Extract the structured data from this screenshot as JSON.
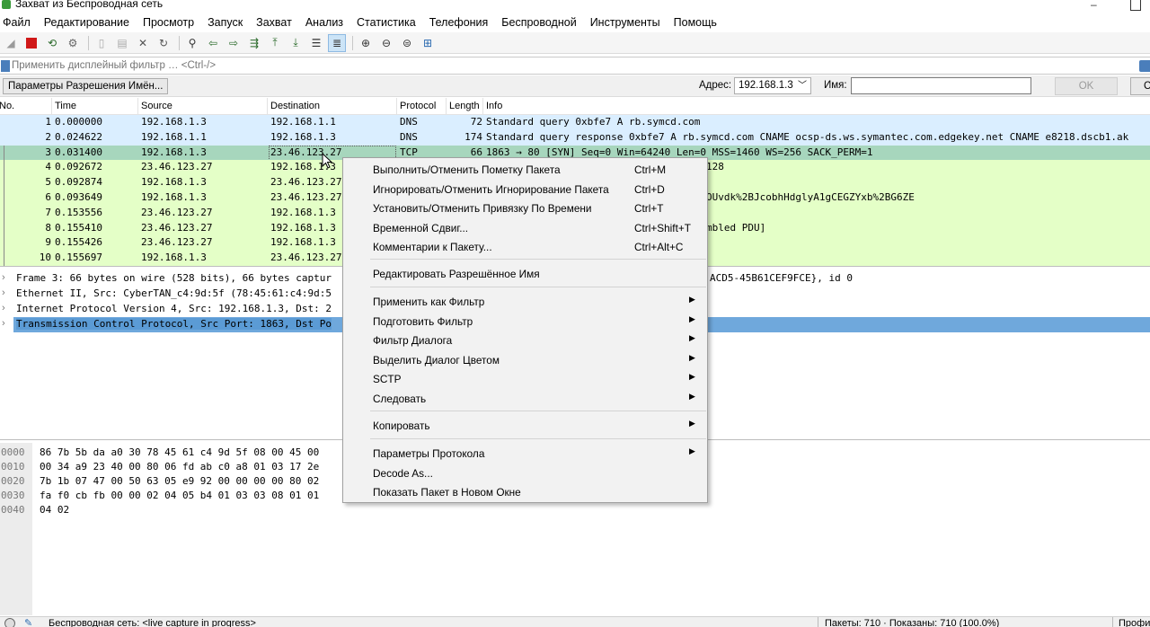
{
  "window": {
    "title": "Захват из Беспроводная сеть"
  },
  "menu": [
    "Файл",
    "Редактирование",
    "Просмотр",
    "Запуск",
    "Захват",
    "Анализ",
    "Статистика",
    "Телефония",
    "Беспроводной",
    "Инструменты",
    "Помощь"
  ],
  "filter": {
    "placeholder": "Применить дисплейный фильтр … <Ctrl-/>"
  },
  "resolve": {
    "button_label": "Параметры Разрешения Имён...",
    "address_label": "Адрес:",
    "address_value": "192.168.1.3",
    "name_label": "Имя:",
    "ok_label": "OK",
    "cancel_label": "С"
  },
  "packet_list": {
    "columns": [
      "No.",
      "Time",
      "Source",
      "Destination",
      "Protocol",
      "Length",
      "Info"
    ],
    "rows": [
      {
        "no": "1",
        "time": "0.000000",
        "source": "192.168.1.3",
        "destination": "192.168.1.1",
        "protocol": "DNS",
        "length": "72",
        "info": "Standard query 0xbfe7 A rb.symcd.com"
      },
      {
        "no": "2",
        "time": "0.024622",
        "source": "192.168.1.1",
        "destination": "192.168.1.3",
        "protocol": "DNS",
        "length": "174",
        "info": "Standard query response 0xbfe7 A rb.symcd.com CNAME ocsp-ds.ws.symantec.com.edgekey.net CNAME e8218.dscb1.ak"
      },
      {
        "no": "3",
        "time": "0.031400",
        "source": "192.168.1.3",
        "destination": "23.46.123.27",
        "protocol": "TCP",
        "length": "66",
        "info": "1863 → 80 [SYN] Seq=0 Win=64240 Len=0 MSS=1460 WS=256 SACK_PERM=1"
      },
      {
        "no": "4",
        "time": "0.092672",
        "source": "23.46.123.27",
        "destination": "192.168.1.3",
        "protocol": "",
        "length": "",
        "info": "=29200 Len=0 MSS=1452 SACK_PERM=1 WS=128"
      },
      {
        "no": "5",
        "time": "0.092874",
        "source": "192.168.1.3",
        "destination": "23.46.123.27",
        "protocol": "",
        "length": "",
        "info": " Len=0"
      },
      {
        "no": "6",
        "time": "0.093649",
        "source": "192.168.1.3",
        "destination": "23.46.123.27",
        "protocol": "",
        "length": "",
        "info": "DRSYViRCZTxmZjLENmnwVjLly9QQU1MAGIknrOUvdk%2BJcobhHdglyA1gCEGZYxb%2BG6ZE"
      },
      {
        "no": "7",
        "time": "0.153556",
        "source": "23.46.123.27",
        "destination": "192.168.1.3",
        "protocol": "",
        "length": "",
        "info": "336 Len=0"
      },
      {
        "no": "8",
        "time": "0.155410",
        "source": "23.46.123.27",
        "destination": "192.168.1.3",
        "protocol": "",
        "length": "",
        "info": "336 Len=1440 [TCP segment of a reassembled PDU]"
      },
      {
        "no": "9",
        "time": "0.155426",
        "source": "23.46.123.27",
        "destination": "192.168.1.3",
        "protocol": "",
        "length": "",
        "info": ""
      },
      {
        "no": "10",
        "time": "0.155697",
        "source": "192.168.1.3",
        "destination": "23.46.123.27",
        "protocol": "",
        "length": "",
        "info": "=66560 Len=0"
      }
    ]
  },
  "details": [
    {
      "text": "Frame 3: 66 bytes on wire (528 bits), 66 bytes captur",
      "tail": "ACD5-45B61CEF9FCE}, id 0"
    },
    {
      "text": "Ethernet II, Src: CyberTAN_c4:9d:5f (78:45:61:c4:9d:5",
      "tail": ""
    },
    {
      "text": "Internet Protocol Version 4, Src: 192.168.1.3, Dst: 2",
      "tail": ""
    },
    {
      "text": "Transmission Control Protocol, Src Port: 1863, Dst Po",
      "tail": ""
    }
  ],
  "bytes": [
    {
      "offset": "0000",
      "hex": "86 7b 5b da a0 30 78 45  61 c4 9d 5f 08 00 45 00"
    },
    {
      "offset": "0010",
      "hex": "00 34 a9 23 40 00 80 06  fd ab c0 a8 01 03 17 2e"
    },
    {
      "offset": "0020",
      "hex": "7b 1b 07 47 00 50 63 05  e9 92 00 00 00 00 80 02"
    },
    {
      "offset": "0030",
      "hex": "fa f0 cb fb 00 00 02 04  05 b4 01 03 03 08 01 01"
    },
    {
      "offset": "0040",
      "hex": "04 02"
    }
  ],
  "context_menu": {
    "items": [
      {
        "label": "Выполнить/Отменить Пометку Пакета",
        "shortcut": "Ctrl+M"
      },
      {
        "label": "Игнорировать/Отменить Игнорирование Пакета",
        "shortcut": "Ctrl+D"
      },
      {
        "label": "Установить/Отменить Привязку По Времени",
        "shortcut": "Ctrl+T"
      },
      {
        "label": "Временной Сдвиг...",
        "shortcut": "Ctrl+Shift+T"
      },
      {
        "label": "Комментарии к Пакету...",
        "shortcut": "Ctrl+Alt+C"
      },
      {
        "label": "Редактировать Разрешённое Имя",
        "shortcut": ""
      },
      {
        "label": "Применить как Фильтр",
        "shortcut": ""
      },
      {
        "label": "Подготовить Фильтр",
        "shortcut": ""
      },
      {
        "label": "Фильтр Диалога",
        "shortcut": ""
      },
      {
        "label": "Выделить Диалог Цветом",
        "shortcut": ""
      },
      {
        "label": "SCTP",
        "shortcut": ""
      },
      {
        "label": "Следовать",
        "shortcut": ""
      },
      {
        "label": "Копировать",
        "shortcut": ""
      },
      {
        "label": "Параметры Протокола",
        "shortcut": ""
      },
      {
        "label": "Decode As...",
        "shortcut": ""
      },
      {
        "label": "Показать Пакет в Новом Окне",
        "shortcut": ""
      }
    ]
  },
  "status": {
    "capture_text": "Беспроводная сеть: <live capture in progress>",
    "packets_text": "Пакеты: 710 · Показаны: 710 (100.0%)",
    "profile_text": "Профи"
  }
}
